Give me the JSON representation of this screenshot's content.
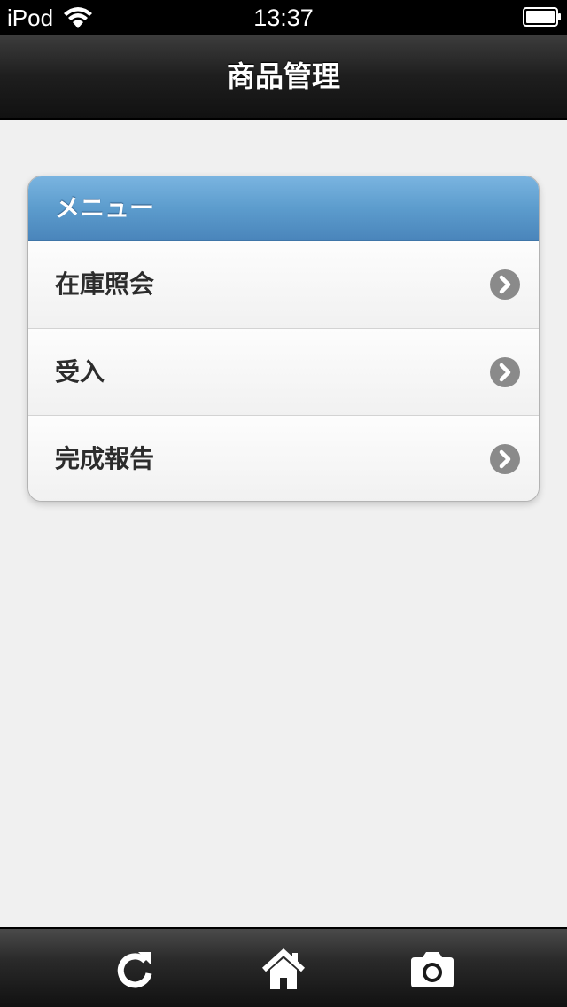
{
  "status_bar": {
    "carrier": "iPod",
    "time": "13:37"
  },
  "header": {
    "title": "商品管理"
  },
  "menu": {
    "divider_label": "メニュー",
    "items": [
      {
        "label": "在庫照会",
        "icon": "chevron-right-circle-icon"
      },
      {
        "label": "受入",
        "icon": "chevron-right-circle-icon"
      },
      {
        "label": "完成報告",
        "icon": "chevron-right-circle-icon"
      }
    ]
  },
  "toolbar": {
    "buttons": [
      {
        "icon": "reload-icon"
      },
      {
        "icon": "home-icon"
      },
      {
        "icon": "camera-icon"
      }
    ]
  },
  "colors": {
    "header_bg": "#1e1e1e",
    "divider_bg": "#5c9ccd",
    "page_bg": "#f0f0f0",
    "arrow_bg": "#8a8a8a"
  }
}
